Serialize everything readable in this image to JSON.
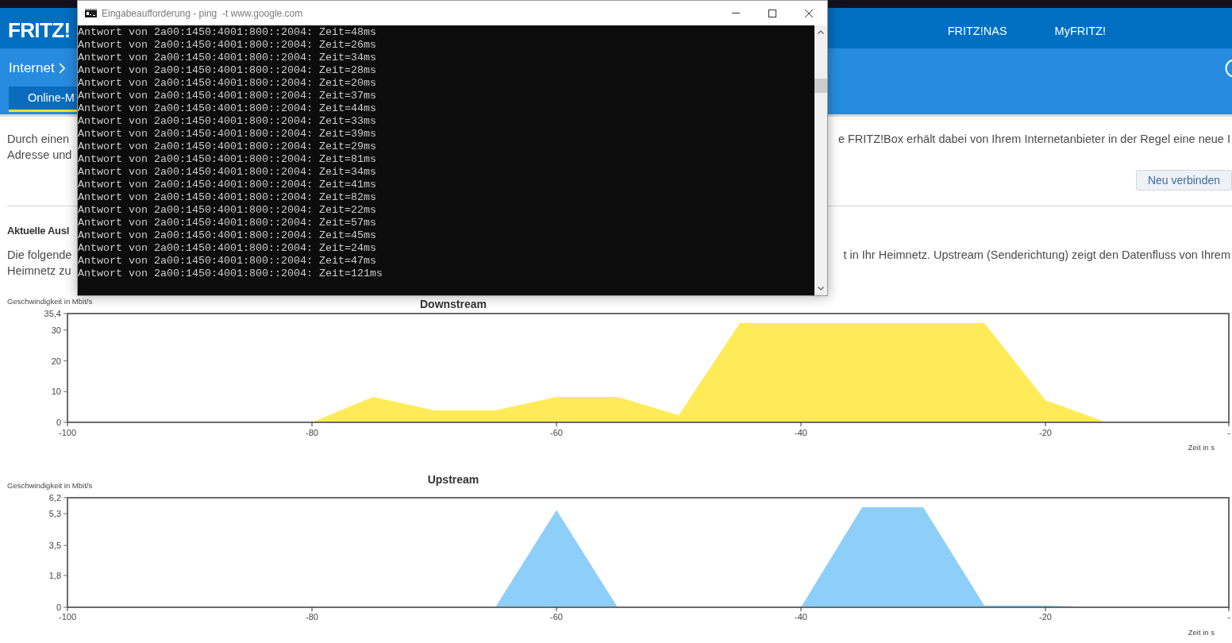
{
  "header": {
    "logo": "FRITZ!",
    "nav": [
      "FRITZ!NAS",
      "MyFRITZ!"
    ]
  },
  "subbar": {
    "breadcrumb": [
      "Internet"
    ],
    "tabs": [
      {
        "label": "Online-M",
        "selected": true
      }
    ]
  },
  "console_window": {
    "title": "Eingabeaufforderung - ping  -t www.google.com",
    "lines": [
      "Antwort von 2a00:1450:4001:800::2004: Zeit=48ms",
      "Antwort von 2a00:1450:4001:800::2004: Zeit=26ms",
      "Antwort von 2a00:1450:4001:800::2004: Zeit=34ms",
      "Antwort von 2a00:1450:4001:800::2004: Zeit=28ms",
      "Antwort von 2a00:1450:4001:800::2004: Zeit=20ms",
      "Antwort von 2a00:1450:4001:800::2004: Zeit=37ms",
      "Antwort von 2a00:1450:4001:800::2004: Zeit=44ms",
      "Antwort von 2a00:1450:4001:800::2004: Zeit=33ms",
      "Antwort von 2a00:1450:4001:800::2004: Zeit=39ms",
      "Antwort von 2a00:1450:4001:800::2004: Zeit=29ms",
      "Antwort von 2a00:1450:4001:800::2004: Zeit=81ms",
      "Antwort von 2a00:1450:4001:800::2004: Zeit=34ms",
      "Antwort von 2a00:1450:4001:800::2004: Zeit=41ms",
      "Antwort von 2a00:1450:4001:800::2004: Zeit=82ms",
      "Antwort von 2a00:1450:4001:800::2004: Zeit=22ms",
      "Antwort von 2a00:1450:4001:800::2004: Zeit=57ms",
      "Antwort von 2a00:1450:4001:800::2004: Zeit=45ms",
      "Antwort von 2a00:1450:4001:800::2004: Zeit=24ms",
      "Antwort von 2a00:1450:4001:800::2004: Zeit=47ms",
      "Antwort von 2a00:1450:4001:800::2004: Zeit=121ms"
    ]
  },
  "intro": {
    "lines": [
      {
        "left": "Durch einen",
        "right": "e FRITZ!Box erhält dabei von Ihrem Internetanbieter in der Regel eine neue I"
      },
      {
        "left": "Adresse und"
      }
    ],
    "button": "Neu verbinden"
  },
  "usage": {
    "heading": "Aktuelle Ausl",
    "lines": [
      {
        "left": "Die folgende",
        "right": "t in Ihr Heimnetz. Upstream (Senderichtung) zeigt den Datenfluss von Ihrem"
      },
      {
        "left": "Heimnetz zu"
      }
    ]
  },
  "downstream_chart": {
    "chart_data": {
      "type": "area",
      "title": "Downstream",
      "xlabel": "Zeit in s",
      "ylabel": "Geschwindigkeit in Mbit/s",
      "x": [
        -100,
        -95,
        -90,
        -85,
        -80,
        -75,
        -70,
        -65,
        -60,
        -55,
        -50,
        -45,
        -40,
        -35,
        -30,
        -25,
        -20,
        -15,
        -10,
        -5
      ],
      "series": [
        {
          "color": "#ffeb57",
          "values": [
            0,
            0,
            0,
            0,
            0,
            8.3,
            3.9,
            3.9,
            8.3,
            8.3,
            2.3,
            32.3,
            32.3,
            32.3,
            32.3,
            32.3,
            7.2,
            0,
            0,
            0
          ]
        }
      ],
      "xlim": [
        -100,
        -5
      ],
      "ylim": [
        0,
        35.4
      ],
      "xticks": [
        -100,
        -80,
        -60,
        -40,
        -20,
        {
          "value": -5,
          "label": "-"
        }
      ],
      "yticks": [
        0,
        10,
        20,
        30,
        {
          "value": 35.4,
          "label": "35,4"
        }
      ]
    }
  },
  "upstream_chart": {
    "chart_data": {
      "type": "area",
      "title": "Upstream",
      "xlabel": "Zeit in s",
      "ylabel": "Geschwindigkeit in Mbit/s",
      "x": [
        -100,
        -95,
        -90,
        -85,
        -80,
        -75,
        -70,
        -65,
        -60,
        -55,
        -50,
        -45,
        -40,
        -35,
        -30,
        -25,
        -20,
        -15,
        -10,
        -5
      ],
      "series": [
        {
          "color": "#8ecffa",
          "values": [
            0,
            0.05,
            0,
            0,
            0,
            0.05,
            0,
            0,
            5.5,
            0,
            0,
            0,
            0,
            5.66,
            5.66,
            0.1,
            0.1,
            0,
            0,
            0
          ]
        }
      ],
      "xlim": [
        -100,
        -5
      ],
      "ylim": [
        0,
        6.2
      ],
      "xticks": [
        -100,
        -80,
        -60,
        -40,
        -20,
        {
          "value": -5,
          "label": "-"
        }
      ],
      "yticks": [
        0,
        {
          "value": 1.8,
          "label": "1,8"
        },
        {
          "value": 3.5,
          "label": "3,5"
        },
        {
          "value": 5.3,
          "label": "5,3"
        },
        {
          "value": 6.2,
          "label": "6,2"
        }
      ]
    }
  }
}
